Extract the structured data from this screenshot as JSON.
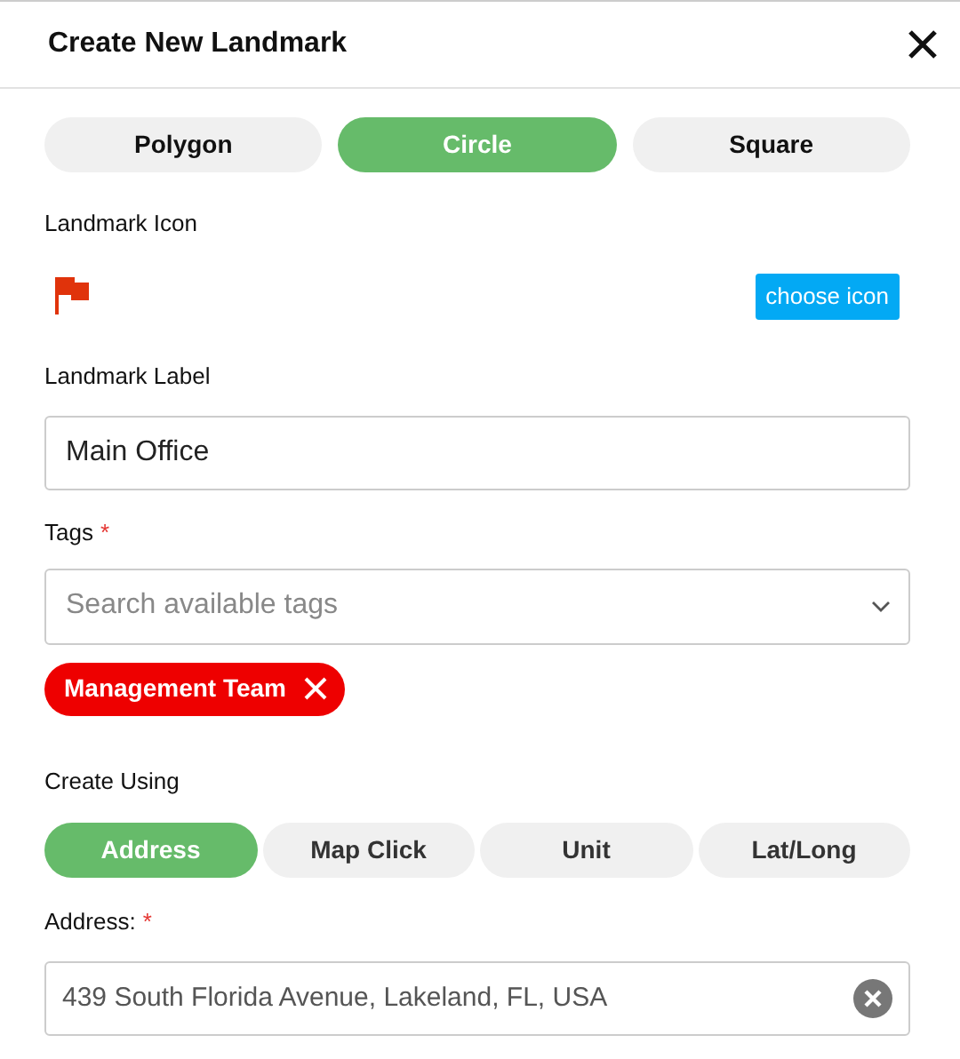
{
  "dialog": {
    "title": "Create New Landmark"
  },
  "shape_tabs": [
    {
      "label": "Polygon",
      "selected": false
    },
    {
      "label": "Circle",
      "selected": true
    },
    {
      "label": "Square",
      "selected": false
    }
  ],
  "icon_section": {
    "label": "Landmark Icon",
    "button": "choose icon"
  },
  "label_field": {
    "label": "Landmark Label",
    "value": "Main Office"
  },
  "tags": {
    "label": "Tags",
    "required_mark": "*",
    "placeholder": "Search available tags",
    "chips": [
      {
        "label": "Management Team"
      }
    ]
  },
  "create_using": {
    "label": "Create Using",
    "tabs": [
      {
        "label": "Address",
        "selected": true
      },
      {
        "label": "Map Click",
        "selected": false
      },
      {
        "label": "Unit",
        "selected": false
      },
      {
        "label": "Lat/Long",
        "selected": false
      }
    ]
  },
  "address": {
    "label": "Address:",
    "required_mark": "*",
    "value": "439 South Florida Avenue, Lakeland, FL, USA"
  }
}
